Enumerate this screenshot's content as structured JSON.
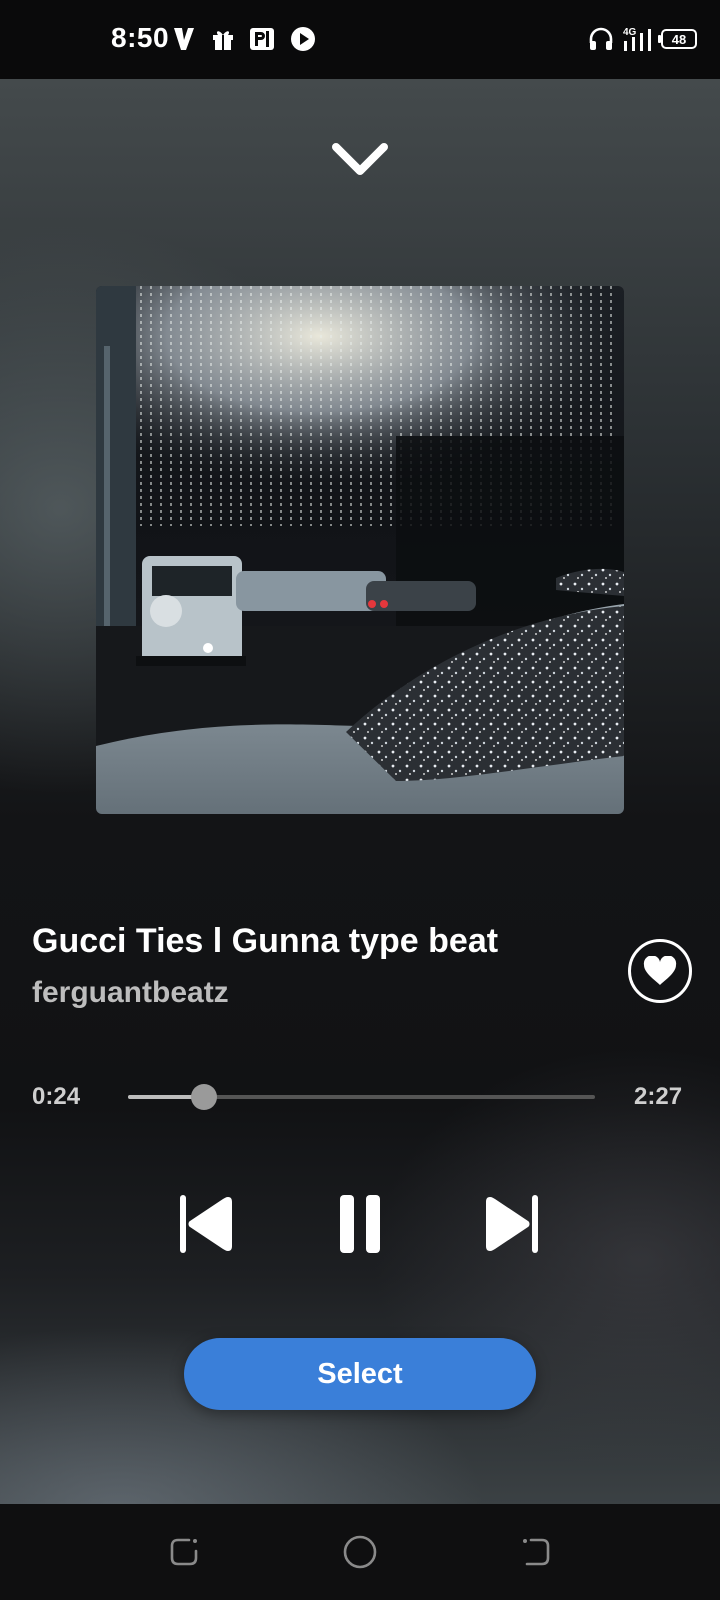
{
  "status_bar": {
    "time": "8:50",
    "battery": "48",
    "network": "4G",
    "left_icons": [
      "v-app-icon",
      "gift-icon",
      "parking-app-icon",
      "play-circle-icon"
    ],
    "right_icons": [
      "headphones-icon",
      "signal-icon",
      "battery-icon"
    ]
  },
  "player": {
    "track_title": "Gucci Ties l Gunna type beat",
    "artist": "ferguantbeatz",
    "time_elapsed": "0:24",
    "time_total": "2:27",
    "progress_fraction": 0.163,
    "liked": true,
    "select_label": "Select"
  },
  "colors": {
    "accent": "#3a7fd9",
    "text_secondary": "#bdbdbd"
  }
}
